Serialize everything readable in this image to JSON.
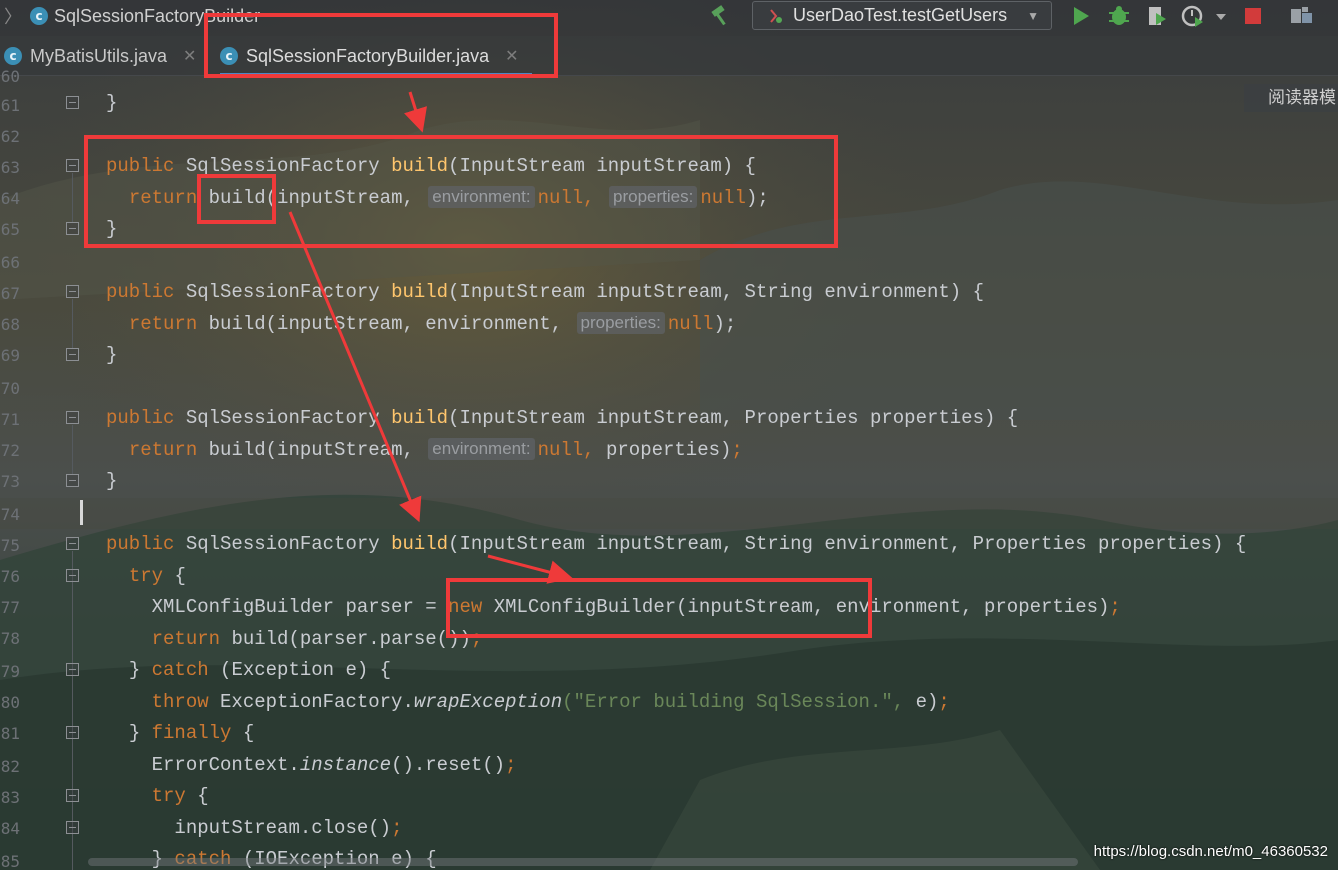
{
  "breadcrumb": {
    "file_label": "SqlSessionFactoryBuilder"
  },
  "run_config": {
    "label": "UserDaoTest.testGetUsers"
  },
  "tabs": [
    {
      "label": "MyBatisUtils.java",
      "active": false
    },
    {
      "label": "SqlSessionFactoryBuilder.java",
      "active": true
    }
  ],
  "reader_mode": {
    "label": "阅读器模"
  },
  "line_numbers": [
    "60",
    "61",
    "62",
    "63",
    "64",
    "65",
    "66",
    "67",
    "68",
    "69",
    "70",
    "71",
    "72",
    "73",
    "74",
    "75",
    "76",
    "77",
    "78",
    "79",
    "80",
    "81",
    "82",
    "83",
    "84",
    "85"
  ],
  "code": {
    "l61": "}",
    "l63_kw": "public",
    "l63_type": "SqlSessionFactory",
    "l63_fn": "build",
    "l63_params": "(InputStream inputStream) {",
    "l64_kw": "return",
    "l64_fn": "build",
    "l64_a": "(inputStream,",
    "l64_h1": "environment:",
    "l64_v1": "null,",
    "l64_h2": "properties:",
    "l64_v2": "null",
    "l64_end": ");",
    "l65": "}",
    "l67_kw": "public",
    "l67_type": "SqlSessionFactory",
    "l67_fn": "build",
    "l67_params": "(InputStream inputStream, String environment) {",
    "l68_kw": "return",
    "l68_a": "build(inputStream, environment,",
    "l68_h1": "properties:",
    "l68_v1": "null",
    "l68_end": ");",
    "l69": "}",
    "l71_kw": "public",
    "l71_type": "SqlSessionFactory",
    "l71_fn": "build",
    "l71_params": "(InputStream inputStream, Properties properties) {",
    "l72_kw": "return",
    "l72_a": "build(inputStream,",
    "l72_h1": "environment:",
    "l72_v1": "null,",
    "l72_b": "properties)",
    "l72_end": ";",
    "l73": "}",
    "l75_kw": "public",
    "l75_type": "SqlSessionFactory",
    "l75_fn": "build",
    "l75_params": "(InputStream inputStream, String environment, Properties properties) {",
    "l76_kw": "try",
    "l76_rest": "{",
    "l77_a": "XMLConfigBuilder parser =",
    "l77_kw": "new",
    "l77_b": "XMLConfigBuilder(inputStream,",
    "l77_c": "environment,",
    "l77_d": "properties)",
    "l77_end": ";",
    "l78_kw": "return",
    "l78_a": "build(parser.parse())",
    "l78_end": ";",
    "l79_a": "}",
    "l79_kw": "catch",
    "l79_b": "(Exception e) {",
    "l80_kw": "throw",
    "l80_a": "ExceptionFactory.",
    "l80_it": "wrapException",
    "l80_s": "(\"Error building SqlSession.\",",
    "l80_b": "e)",
    "l80_end": ";",
    "l81_a": "}",
    "l81_kw": "finally",
    "l81_b": "{",
    "l82_a": "ErrorContext.",
    "l82_it": "instance",
    "l82_b": "().reset()",
    "l82_end": ";",
    "l83_kw": "try",
    "l83_b": "{",
    "l84_a": "inputStream.close()",
    "l84_end": ";",
    "l85_a": "}",
    "l85_kw": "catch",
    "l85_b": "(IOException e) {"
  },
  "watermark": "https://blog.csdn.net/m0_46360532",
  "colors": {
    "annotation": "#ef3a3a",
    "keyword": "#cc7832",
    "method": "#ffc66d",
    "string": "#6a8759"
  }
}
